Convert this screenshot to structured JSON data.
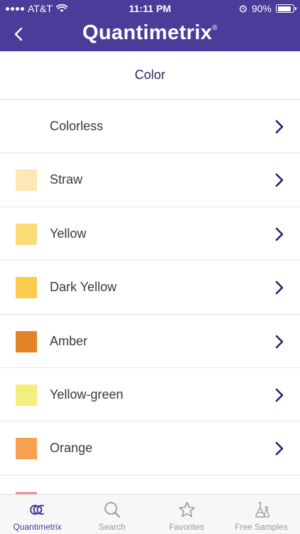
{
  "status_bar": {
    "carrier": "AT&T",
    "time": "11:11 PM",
    "battery": "90%",
    "battery_level": 0.9
  },
  "header": {
    "brand": "Quantimetrix",
    "registered": "®",
    "back_icon": "chevron-left-icon"
  },
  "page": {
    "title": "Color"
  },
  "items": [
    {
      "label": "Colorless",
      "color": null
    },
    {
      "label": "Straw",
      "color": "#fde7b4"
    },
    {
      "label": "Yellow",
      "color": "#fbdb76"
    },
    {
      "label": "Dark Yellow",
      "color": "#fbcc4b"
    },
    {
      "label": "Amber",
      "color": "#e38327"
    },
    {
      "label": "Yellow-green",
      "color": "#f2ee7f"
    },
    {
      "label": "Orange",
      "color": "#f9a050"
    },
    {
      "label": "",
      "color": "#eb959b"
    }
  ],
  "tabs": [
    {
      "label": "Quantimetrix",
      "icon": "quantimetrix-logo-icon",
      "active": true
    },
    {
      "label": "Search",
      "icon": "search-icon",
      "active": false
    },
    {
      "label": "Favorites",
      "icon": "star-icon",
      "active": false
    },
    {
      "label": "Free Samples",
      "icon": "flask-icon",
      "active": false
    }
  ],
  "colors": {
    "header_bg": "#4a3c99",
    "accent": "#2c2460",
    "chevron": "#26216d",
    "tab_inactive": "#9a9a9a"
  }
}
